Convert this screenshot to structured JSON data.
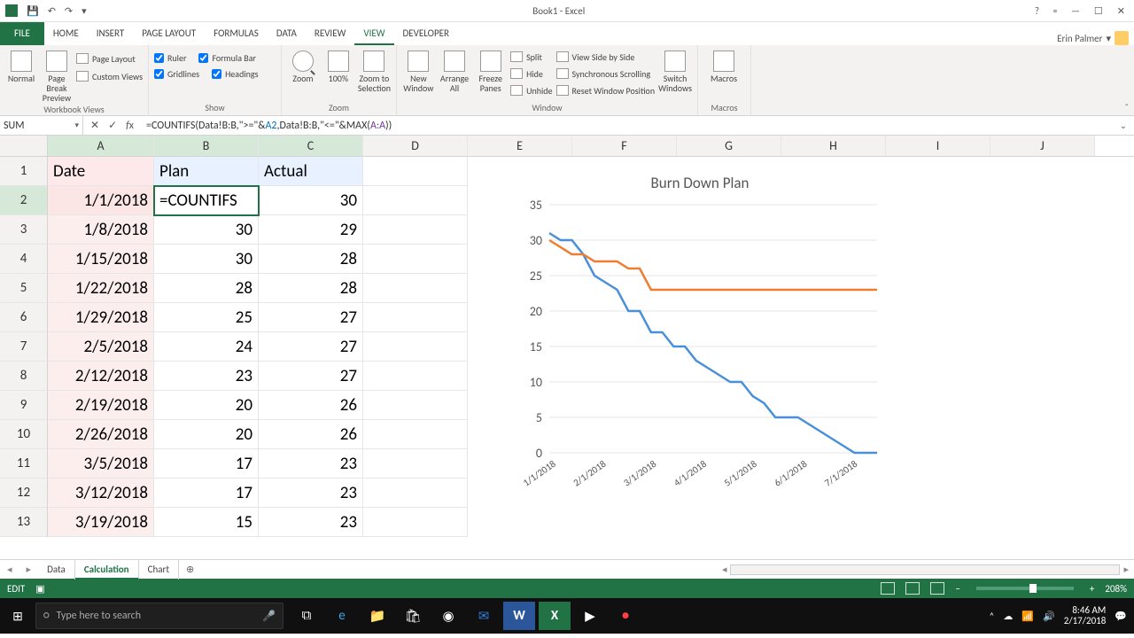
{
  "title": "Book1 - Excel",
  "qat": {
    "save": "💾",
    "undo": "↶",
    "redo": "↷"
  },
  "win": {
    "help": "?",
    "opts": "▫",
    "min": "—",
    "max": "☐",
    "close": "✕"
  },
  "tabs": [
    "HOME",
    "INSERT",
    "PAGE LAYOUT",
    "FORMULAS",
    "DATA",
    "REVIEW",
    "VIEW",
    "DEVELOPER"
  ],
  "tab_file": "FILE",
  "user": "Erin Palmer",
  "ribbon": {
    "views": {
      "normal": "Normal",
      "pbp": "Page Break Preview",
      "pl": "Page Layout",
      "cv": "Custom Views",
      "lbl": "Workbook Views"
    },
    "show": {
      "ruler": "Ruler",
      "fb": "Formula Bar",
      "grid": "Gridlines",
      "head": "Headings",
      "lbl": "Show"
    },
    "zoom": {
      "zoom": "Zoom",
      "z100": "100%",
      "zsel": "Zoom to Selection",
      "lbl": "Zoom"
    },
    "window": {
      "nw": "New Window",
      "aa": "Arrange All",
      "fp": "Freeze Panes",
      "split": "Split",
      "hide": "Hide",
      "unhide": "Unhide",
      "vsbs": "View Side by Side",
      "sync": "Synchronous Scrolling",
      "reset": "Reset Window Position",
      "sw": "Switch Windows",
      "lbl": "Window"
    },
    "macros": {
      "m": "Macros",
      "lbl": "Macros"
    }
  },
  "namebox": "SUM",
  "formula_prefix": "=COUNTIFS(Data!B:B,\">=\"&",
  "formula_ref1": "A2",
  "formula_mid": ",Data!B:B,\"<=\"&MAX(",
  "formula_ref2": "A:A",
  "formula_suffix": "))",
  "cols": [
    "A",
    "B",
    "C",
    "D",
    "E",
    "F",
    "G",
    "H",
    "I",
    "J"
  ],
  "headers": {
    "A": "Date",
    "B": "Plan",
    "C": "Actual"
  },
  "b2_editing": "=COUNTIFS",
  "rows": [
    {
      "n": 2,
      "A": "1/1/2018",
      "B": "",
      "C": "30"
    },
    {
      "n": 3,
      "A": "1/8/2018",
      "B": "30",
      "C": "29"
    },
    {
      "n": 4,
      "A": "1/15/2018",
      "B": "30",
      "C": "28"
    },
    {
      "n": 5,
      "A": "1/22/2018",
      "B": "28",
      "C": "28"
    },
    {
      "n": 6,
      "A": "1/29/2018",
      "B": "25",
      "C": "27"
    },
    {
      "n": 7,
      "A": "2/5/2018",
      "B": "24",
      "C": "27"
    },
    {
      "n": 8,
      "A": "2/12/2018",
      "B": "23",
      "C": "27"
    },
    {
      "n": 9,
      "A": "2/19/2018",
      "B": "20",
      "C": "26"
    },
    {
      "n": 10,
      "A": "2/26/2018",
      "B": "20",
      "C": "26"
    },
    {
      "n": 11,
      "A": "3/5/2018",
      "B": "17",
      "C": "23"
    },
    {
      "n": 12,
      "A": "3/12/2018",
      "B": "17",
      "C": "23"
    },
    {
      "n": 13,
      "A": "3/19/2018",
      "B": "15",
      "C": "23"
    }
  ],
  "chart_data": {
    "type": "line",
    "title": "Burn Down Plan",
    "ylim": [
      0,
      35
    ],
    "yticks": [
      0,
      5,
      10,
      15,
      20,
      25,
      30,
      35
    ],
    "xticks": [
      "1/1/2018",
      "2/1/2018",
      "3/1/2018",
      "4/1/2018",
      "5/1/2018",
      "6/1/2018",
      "7/1/2018"
    ],
    "series": [
      {
        "name": "Plan",
        "color": "#4a90d9",
        "values": [
          31,
          30,
          30,
          28,
          25,
          24,
          23,
          20,
          20,
          17,
          17,
          15,
          15,
          13,
          12,
          11,
          10,
          10,
          8,
          7,
          5,
          5,
          5,
          4,
          3,
          2,
          1,
          0,
          0,
          0
        ]
      },
      {
        "name": "Actual",
        "color": "#ed7d31",
        "values": [
          30,
          29,
          28,
          28,
          27,
          27,
          27,
          26,
          26,
          23,
          23,
          23,
          23,
          23,
          23,
          23,
          23,
          23,
          23,
          23,
          23,
          23,
          23,
          23,
          23,
          23,
          23,
          23,
          23,
          23
        ]
      }
    ]
  },
  "sheet_tabs": [
    "Data",
    "Calculation",
    "Chart"
  ],
  "status": {
    "mode": "EDIT",
    "rec": "▣",
    "zoom": "208%"
  },
  "taskbar": {
    "search_placeholder": "Type here to search",
    "time": "8:46 AM",
    "date": "2/17/2018"
  }
}
